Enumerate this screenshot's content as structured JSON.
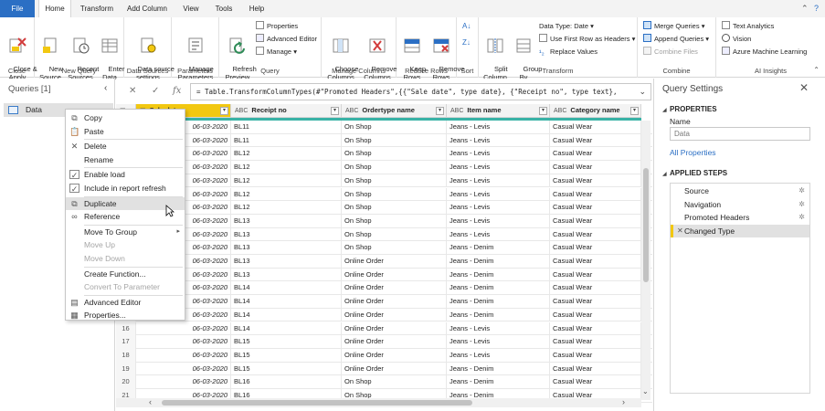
{
  "tabs": [
    "File",
    "Home",
    "Transform",
    "Add Column",
    "View",
    "Tools",
    "Help"
  ],
  "ribbon": {
    "close": {
      "label": "Close",
      "btn": "Close &\nApply"
    },
    "new_query": {
      "label": "New Query",
      "new_source": "New\nSource",
      "recent_sources": "Recent\nSources",
      "enter_data": "Enter\nData"
    },
    "data_sources": {
      "label": "Data Sources",
      "settings": "Data source\nsettings"
    },
    "parameters": {
      "label": "Parameters",
      "manage": "Manage\nParameters"
    },
    "query": {
      "label": "Query",
      "refresh": "Refresh\nPreview",
      "properties": "Properties",
      "advanced_editor": "Advanced Editor",
      "manage": "Manage"
    },
    "manage_columns": {
      "label": "Manage Columns",
      "choose": "Choose\nColumns",
      "remove": "Remove\nColumns"
    },
    "reduce_rows": {
      "label": "Reduce Rows",
      "keep": "Keep\nRows",
      "remove": "Remove\nRows"
    },
    "sort": {
      "label": "Sort"
    },
    "transform": {
      "label": "Transform",
      "split": "Split\nColumn",
      "group": "Group\nBy",
      "data_type": "Data Type: Date",
      "first_row": "Use First Row as Headers",
      "replace": "Replace Values"
    },
    "combine": {
      "label": "Combine",
      "merge": "Merge Queries",
      "append": "Append Queries",
      "files": "Combine Files"
    },
    "ai": {
      "label": "AI Insights",
      "text": "Text Analytics",
      "vision": "Vision",
      "azure": "Azure Machine Learning"
    }
  },
  "queries": {
    "title": "Queries [1]",
    "item": "Data"
  },
  "formula": "= Table.TransformColumnTypes(#\"Promoted Headers\",{{\"Sale date\", type date}, {\"Receipt no\", type text},",
  "columns": [
    {
      "name": "Sale date",
      "type": "▦"
    },
    {
      "name": "Receipt no",
      "type": "ABC"
    },
    {
      "name": "Ordertype name",
      "type": "ABC"
    },
    {
      "name": "Item name",
      "type": "ABC"
    },
    {
      "name": "Category name",
      "type": "ABC"
    }
  ],
  "rows": [
    [
      "1",
      "06-03-2020",
      "BL11",
      "On Shop",
      "Jeans - Levis",
      "Casual Wear"
    ],
    [
      "2",
      "06-03-2020",
      "BL11",
      "On Shop",
      "Jeans - Levis",
      "Casual Wear"
    ],
    [
      "3",
      "06-03-2020",
      "BL12",
      "On Shop",
      "Jeans - Levis",
      "Casual Wear"
    ],
    [
      "4",
      "06-03-2020",
      "BL12",
      "On Shop",
      "Jeans - Levis",
      "Casual Wear"
    ],
    [
      "5",
      "06-03-2020",
      "BL12",
      "On Shop",
      "Jeans - Levis",
      "Casual Wear"
    ],
    [
      "6",
      "06-03-2020",
      "BL12",
      "On Shop",
      "Jeans - Levis",
      "Casual Wear"
    ],
    [
      "7",
      "06-03-2020",
      "BL12",
      "On Shop",
      "Jeans - Levis",
      "Casual Wear"
    ],
    [
      "8",
      "06-03-2020",
      "BL13",
      "On Shop",
      "Jeans - Levis",
      "Casual Wear"
    ],
    [
      "9",
      "06-03-2020",
      "BL13",
      "On Shop",
      "Jeans - Levis",
      "Casual Wear"
    ],
    [
      "10",
      "06-03-2020",
      "BL13",
      "On Shop",
      "Jeans - Denim",
      "Casual Wear"
    ],
    [
      "11",
      "06-03-2020",
      "BL13",
      "Online Order",
      "Jeans - Denim",
      "Casual Wear"
    ],
    [
      "12",
      "06-03-2020",
      "BL13",
      "Online Order",
      "Jeans - Denim",
      "Casual Wear"
    ],
    [
      "13",
      "06-03-2020",
      "BL14",
      "Online Order",
      "Jeans - Denim",
      "Casual Wear"
    ],
    [
      "14",
      "06-03-2020",
      "BL14",
      "Online Order",
      "Jeans - Denim",
      "Casual Wear"
    ],
    [
      "15",
      "06-03-2020",
      "BL14",
      "Online Order",
      "Jeans - Denim",
      "Casual Wear"
    ],
    [
      "16",
      "06-03-2020",
      "BL14",
      "Online Order",
      "Jeans - Levis",
      "Casual Wear"
    ],
    [
      "17",
      "06-03-2020",
      "BL15",
      "Online Order",
      "Jeans - Levis",
      "Casual Wear"
    ],
    [
      "18",
      "06-03-2020",
      "BL15",
      "Online Order",
      "Jeans - Levis",
      "Casual Wear"
    ],
    [
      "19",
      "06-03-2020",
      "BL15",
      "Online Order",
      "Jeans - Denim",
      "Casual Wear"
    ],
    [
      "20",
      "06-03-2020",
      "BL16",
      "On Shop",
      "Jeans - Denim",
      "Casual Wear"
    ],
    [
      "21",
      "06-03-2020",
      "BL16",
      "On Shop",
      "Jeans - Denim",
      "Casual Wear"
    ]
  ],
  "context_menu": [
    {
      "label": "Copy",
      "icon": "copy-icon",
      "state": "normal"
    },
    {
      "label": "Paste",
      "icon": "paste-icon",
      "state": "normal"
    },
    {
      "sep": true
    },
    {
      "label": "Delete",
      "icon": "delete-icon",
      "state": "normal"
    },
    {
      "label": "Rename",
      "icon": "",
      "state": "normal"
    },
    {
      "sep": true
    },
    {
      "label": "Enable load",
      "icon": "checkbox-checked-icon",
      "state": "normal"
    },
    {
      "label": "Include in report refresh",
      "icon": "checkbox-checked-icon",
      "state": "normal"
    },
    {
      "sep": true
    },
    {
      "label": "Duplicate",
      "icon": "duplicate-icon",
      "state": "highlight"
    },
    {
      "label": "Reference",
      "icon": "reference-icon",
      "state": "normal"
    },
    {
      "sep": true
    },
    {
      "label": "Move To Group",
      "icon": "",
      "state": "submenu"
    },
    {
      "label": "Move Up",
      "icon": "",
      "state": "disabled"
    },
    {
      "label": "Move Down",
      "icon": "",
      "state": "disabled"
    },
    {
      "sep": true
    },
    {
      "label": "Create Function...",
      "icon": "",
      "state": "normal"
    },
    {
      "label": "Convert To Parameter",
      "icon": "",
      "state": "disabled"
    },
    {
      "sep": true
    },
    {
      "label": "Advanced Editor",
      "icon": "advanced-editor-icon",
      "state": "normal"
    },
    {
      "label": "Properties...",
      "icon": "properties-icon",
      "state": "normal"
    }
  ],
  "settings": {
    "title": "Query Settings",
    "properties_head": "PROPERTIES",
    "name_label": "Name",
    "name_value": "Data",
    "all_properties": "All Properties",
    "steps_head": "APPLIED STEPS",
    "steps": [
      {
        "label": "Source",
        "gear": true
      },
      {
        "label": "Navigation",
        "gear": true
      },
      {
        "label": "Promoted Headers",
        "gear": true
      },
      {
        "label": "Changed Type",
        "gear": false,
        "active": true
      }
    ]
  },
  "colors": {
    "accent": "#f2c811",
    "file_tab": "#2b6fc4",
    "quality": "#39b2a6"
  }
}
